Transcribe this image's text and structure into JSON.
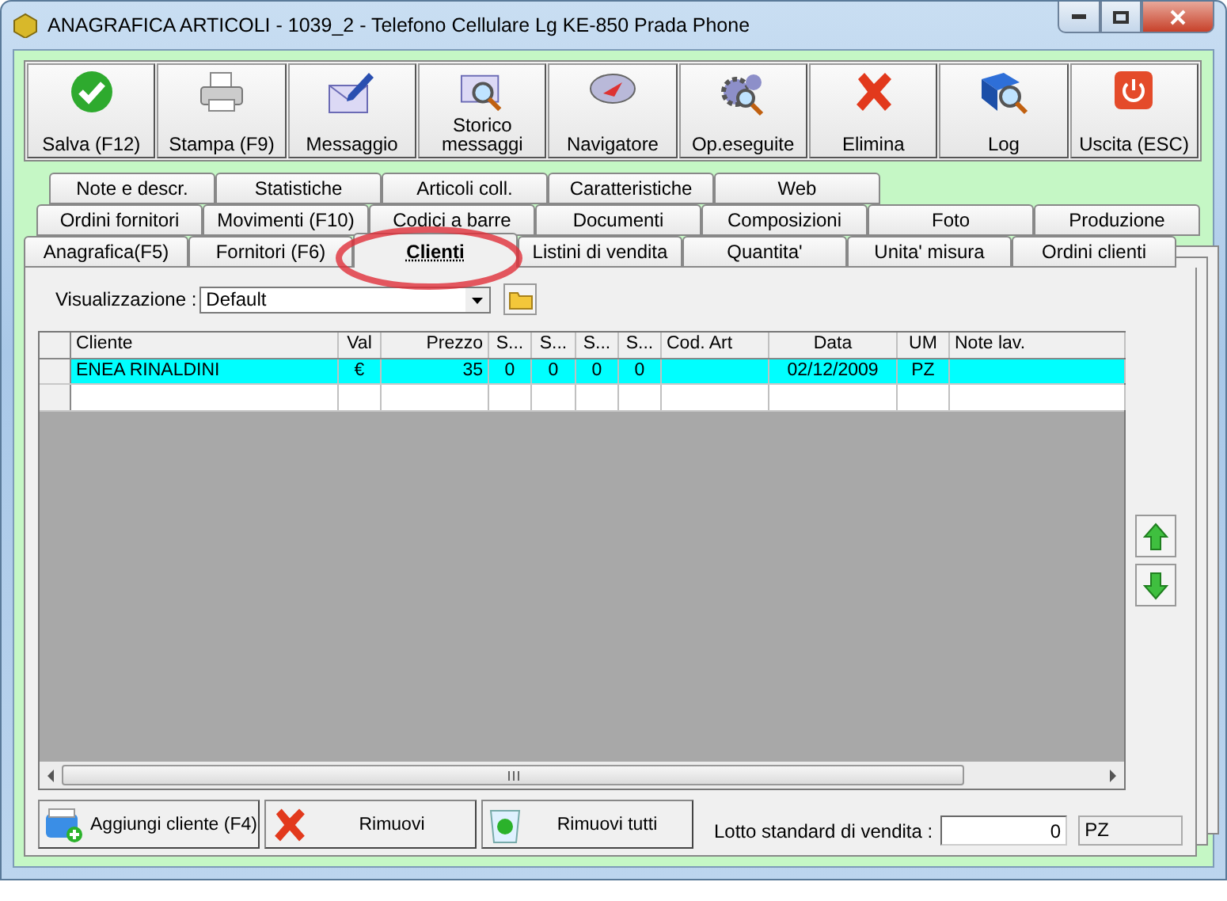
{
  "window": {
    "title": "ANAGRAFICA ARTICOLI - 1039_2 - Telefono Cellulare Lg KE-850 Prada Phone"
  },
  "toolbar": [
    {
      "label": "Salva (F12)"
    },
    {
      "label": "Stampa (F9)"
    },
    {
      "label": "Messaggio"
    },
    {
      "label": "Storico messaggi"
    },
    {
      "label": "Navigatore"
    },
    {
      "label": "Op.eseguite"
    },
    {
      "label": "Elimina"
    },
    {
      "label": "Log"
    },
    {
      "label": "Uscita (ESC)"
    }
  ],
  "tab_rows": [
    [
      {
        "label": "Note e descr.",
        "selected": false
      },
      {
        "label": "Statistiche",
        "selected": false
      },
      {
        "label": "Articoli coll.",
        "selected": false
      },
      {
        "label": "Caratteristiche",
        "selected": false
      },
      {
        "label": "Web",
        "selected": false
      }
    ],
    [
      {
        "label": "Ordini fornitori",
        "selected": false
      },
      {
        "label": "Movimenti (F10)",
        "selected": false
      },
      {
        "label": "Codici a barre",
        "selected": false
      },
      {
        "label": "Documenti",
        "selected": false
      },
      {
        "label": "Composizioni",
        "selected": false
      },
      {
        "label": "Foto",
        "selected": false
      },
      {
        "label": "Produzione",
        "selected": false
      }
    ],
    [
      {
        "label": "Anagrafica(F5)",
        "selected": false
      },
      {
        "label": "Fornitori (F6)",
        "selected": false
      },
      {
        "label": "Clienti",
        "selected": true
      },
      {
        "label": "Listini di vendita",
        "selected": false
      },
      {
        "label": "Quantita'",
        "selected": false
      },
      {
        "label": "Unita' misura",
        "selected": false
      },
      {
        "label": "Ordini clienti",
        "selected": false
      }
    ]
  ],
  "view": {
    "label": "Visualizzazione :",
    "value": "Default"
  },
  "table": {
    "columns": [
      {
        "label": "Cliente"
      },
      {
        "label": "Val"
      },
      {
        "label": "Prezzo"
      },
      {
        "label": "S..."
      },
      {
        "label": "S..."
      },
      {
        "label": "S..."
      },
      {
        "label": "S..."
      },
      {
        "label": "Cod. Art"
      },
      {
        "label": "Data"
      },
      {
        "label": "UM"
      },
      {
        "label": "Note lav."
      }
    ],
    "rows": [
      {
        "selected": true,
        "cells": [
          "ENEA RINALDINI",
          "€",
          "35",
          "0",
          "0",
          "0",
          "0",
          "",
          "02/12/2009",
          "PZ",
          ""
        ]
      }
    ]
  },
  "actions": [
    {
      "label": "Aggiungi cliente (F4)"
    },
    {
      "label": "Rimuovi"
    },
    {
      "label": "Rimuovi tutti"
    }
  ],
  "lotto": {
    "label": "Lotto standard di vendita :",
    "value": "0",
    "unit": "PZ"
  }
}
